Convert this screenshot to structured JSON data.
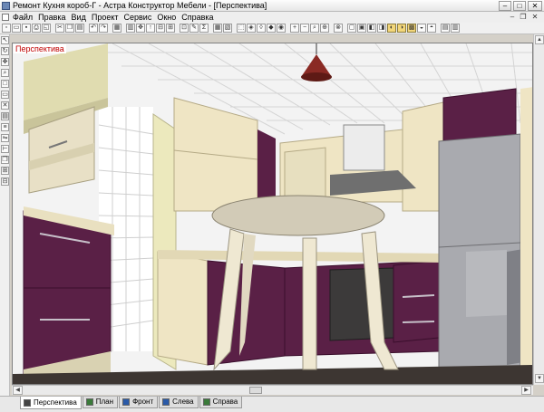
{
  "window": {
    "title": "Ремонт Кухня короб-Г - Астра Конструктор Мебели - [Перспектива]",
    "buttons": {
      "minimize": "–",
      "maximize": "□",
      "close": "✕"
    }
  },
  "menu": {
    "items": [
      "Файл",
      "Правка",
      "Вид",
      "Проект",
      "Сервис",
      "Окно",
      "Справка"
    ],
    "mdi": {
      "minimize": "–",
      "restore": "❐",
      "close": "✕"
    }
  },
  "toolbar": {
    "icons": [
      {
        "name": "new-icon",
        "glyph": "▫"
      },
      {
        "name": "open-icon",
        "glyph": "▭"
      },
      {
        "name": "save-icon",
        "glyph": "▪"
      },
      {
        "name": "print-icon",
        "glyph": "⎙"
      },
      {
        "name": "preview-icon",
        "glyph": "◱"
      },
      {
        "name": "sep"
      },
      {
        "name": "cut-icon",
        "glyph": "✂"
      },
      {
        "name": "copy-icon",
        "glyph": "❐"
      },
      {
        "name": "paste-icon",
        "glyph": "▤"
      },
      {
        "name": "sep"
      },
      {
        "name": "undo-icon",
        "glyph": "↶"
      },
      {
        "name": "redo-icon",
        "glyph": "↷"
      },
      {
        "name": "sep"
      },
      {
        "name": "table-icon",
        "glyph": "▦"
      },
      {
        "name": "sep"
      },
      {
        "name": "detail-icon",
        "glyph": "▥"
      },
      {
        "name": "move-icon",
        "glyph": "✥"
      },
      {
        "name": "up-icon",
        "glyph": "↑"
      },
      {
        "name": "split-icon",
        "glyph": "⊟"
      },
      {
        "name": "frame-icon",
        "glyph": "⊞"
      },
      {
        "name": "sep"
      },
      {
        "name": "lock-icon",
        "glyph": "⊡"
      },
      {
        "name": "edit-icon",
        "glyph": "✎"
      },
      {
        "name": "sum-icon",
        "glyph": "Σ"
      },
      {
        "name": "sep"
      },
      {
        "name": "grid-icon",
        "glyph": "▦"
      },
      {
        "name": "grid2-icon",
        "glyph": "▧"
      },
      {
        "name": "sep"
      },
      {
        "name": "box-icon",
        "glyph": "⬚"
      },
      {
        "name": "cube-icon",
        "glyph": "◈"
      },
      {
        "name": "edge-icon",
        "glyph": "◊"
      },
      {
        "name": "paint-icon",
        "glyph": "◆"
      },
      {
        "name": "mat-icon",
        "glyph": "◉"
      },
      {
        "name": "sep"
      },
      {
        "name": "zoom-in-icon",
        "glyph": "+"
      },
      {
        "name": "zoom-out-icon",
        "glyph": "−"
      },
      {
        "name": "zoom-fit-icon",
        "glyph": "⌕"
      },
      {
        "name": "zoom-all-icon",
        "glyph": "⊕"
      },
      {
        "name": "sep"
      },
      {
        "name": "target-icon",
        "glyph": "⊗"
      },
      {
        "name": "sep"
      },
      {
        "name": "view1-icon",
        "glyph": "▢"
      },
      {
        "name": "view2-icon",
        "glyph": "▣"
      },
      {
        "name": "view3-icon",
        "glyph": "◧"
      },
      {
        "name": "view4-icon",
        "glyph": "◨"
      },
      {
        "name": "render-icon",
        "glyph": "◐",
        "on": true
      },
      {
        "name": "shade-icon",
        "glyph": "◑",
        "on": true
      },
      {
        "name": "tex-icon",
        "glyph": "▩",
        "on": true
      },
      {
        "name": "light-icon",
        "glyph": "◒"
      },
      {
        "name": "cam-icon",
        "glyph": "◓"
      },
      {
        "name": "sep"
      },
      {
        "name": "view5-icon",
        "glyph": "▤"
      },
      {
        "name": "view6-icon",
        "glyph": "▥"
      }
    ]
  },
  "left_tools": [
    {
      "name": "pointer-icon",
      "glyph": "↖"
    },
    {
      "name": "rotate-icon",
      "glyph": "↻"
    },
    {
      "name": "pan-icon",
      "glyph": "✥"
    },
    {
      "name": "zoom-icon",
      "glyph": "⌕"
    },
    {
      "name": "box-tool-icon",
      "glyph": "□"
    },
    {
      "name": "panel-tool-icon",
      "glyph": "▭"
    },
    {
      "name": "delete-tool-icon",
      "glyph": "✕"
    },
    {
      "name": "layers-icon",
      "glyph": "▤"
    },
    {
      "name": "align-icon",
      "glyph": "≡"
    },
    {
      "name": "mirror-icon",
      "glyph": "⇋"
    },
    {
      "name": "measure-icon",
      "glyph": "⊢"
    },
    {
      "name": "copy-tool-icon",
      "glyph": "❐"
    },
    {
      "name": "group-icon",
      "glyph": "⊞"
    },
    {
      "name": "ungroup-icon",
      "glyph": "⊟"
    }
  ],
  "viewport": {
    "label": "Перспектива"
  },
  "tabs": [
    {
      "label": "Перспектива",
      "active": true,
      "icon": "perspective-icon",
      "color": "#444444"
    },
    {
      "label": "План",
      "active": false,
      "icon": "plan-icon",
      "color": "#3a7a3a"
    },
    {
      "label": "Фронт",
      "active": false,
      "icon": "front-icon",
      "color": "#2a5aa8"
    },
    {
      "label": "Слева",
      "active": false,
      "icon": "left-icon",
      "color": "#2a5aa8"
    },
    {
      "label": "Справа",
      "active": false,
      "icon": "right-icon",
      "color": "#3a7a3a"
    }
  ],
  "colors": {
    "cabinet_purple": "#5a2046",
    "cabinet_cream": "#efe5c4",
    "wall_cream": "#ecebc0",
    "floor": "#3d3632",
    "fridge": "#a9aaaf",
    "lamp": "#8a2a24",
    "active_view_label": "#c00000"
  }
}
